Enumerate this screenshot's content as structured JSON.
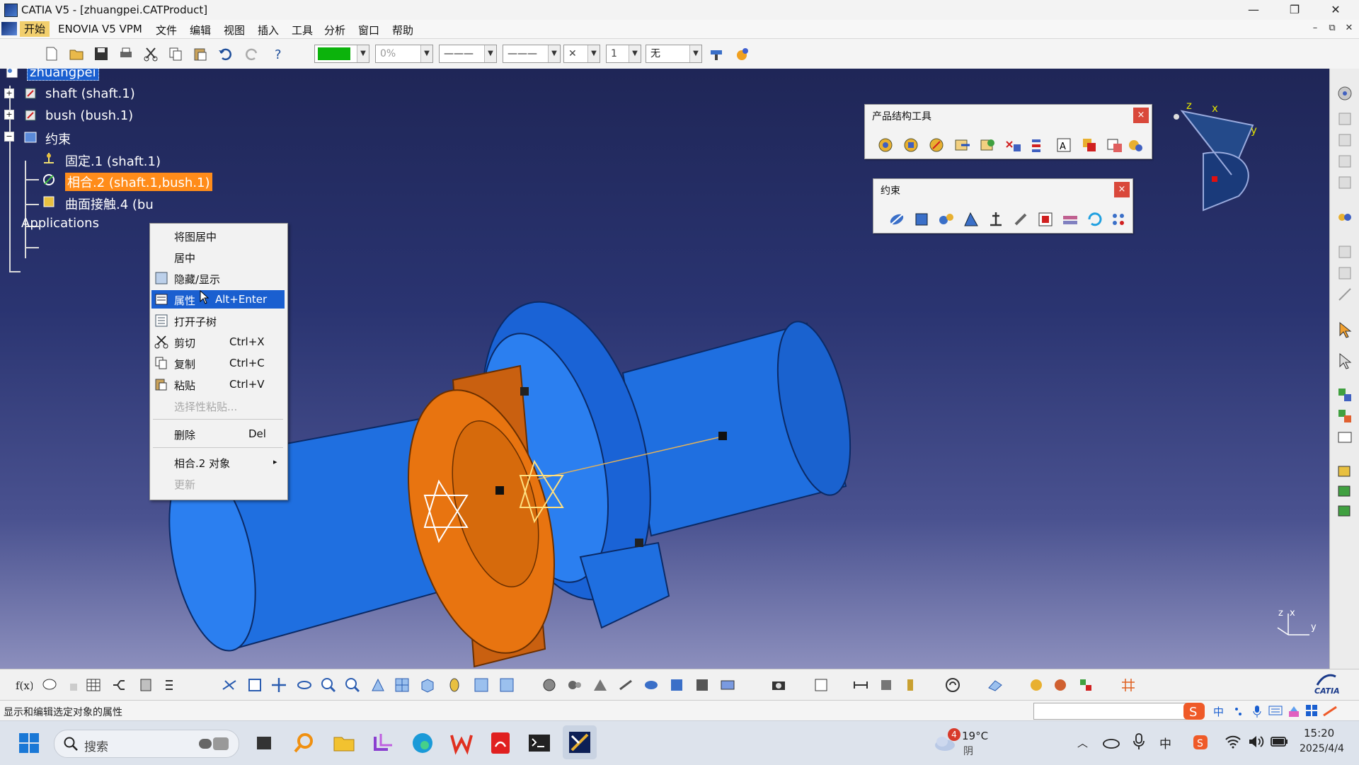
{
  "window": {
    "title": "CATIA V5 - [zhuangpei.CATProduct]",
    "controls": [
      "—",
      "❐",
      "✕"
    ]
  },
  "menubar": {
    "items": [
      "开始",
      "ENOVIA V5 VPM",
      "文件",
      "编辑",
      "视图",
      "插入",
      "工具",
      "分析",
      "窗口",
      "帮助"
    ],
    "mdi_controls": [
      "–",
      "⧉",
      "✕"
    ]
  },
  "toolbar": {
    "color_value": "",
    "transparency_value": "0%",
    "layer_value": "无",
    "linetype_value": "———",
    "lineweight_value": "———",
    "point_value": "✕",
    "misc_value": "1"
  },
  "tree": {
    "root": "zhuangpei",
    "items": [
      {
        "label": "shaft (shaft.1)"
      },
      {
        "label": "bush (bush.1)"
      },
      {
        "label": "约束"
      },
      {
        "label": "固定.1 (shaft.1)"
      },
      {
        "label": "相合.2 (shaft.1,bush.1)"
      },
      {
        "label": "曲面接触.4 (bu"
      },
      {
        "label": "Applications"
      }
    ]
  },
  "panels": {
    "product_tools": {
      "title": "产品结构工具",
      "close": "×"
    },
    "constraints": {
      "title": "约束",
      "close": "×"
    }
  },
  "compass": {
    "x": "x",
    "y": "y",
    "z": "z"
  },
  "axis_triad": {
    "z": "z",
    "x": "x",
    "y": "y"
  },
  "context_menu": {
    "items": [
      {
        "label": "将图居中",
        "shortcut": ""
      },
      {
        "label": "居中",
        "shortcut": ""
      },
      {
        "label": "隐藏/显示",
        "shortcut": ""
      },
      {
        "label": "属性",
        "shortcut": "Alt+Enter"
      },
      {
        "label": "打开子树",
        "shortcut": ""
      },
      {
        "label": "剪切",
        "shortcut": "Ctrl+X"
      },
      {
        "label": "复制",
        "shortcut": "Ctrl+C"
      },
      {
        "label": "粘贴",
        "shortcut": "Ctrl+V"
      },
      {
        "label": "选择性粘贴...",
        "shortcut": ""
      },
      {
        "label": "删除",
        "shortcut": "Del"
      },
      {
        "label": "相合.2 对象",
        "shortcut": "▸"
      },
      {
        "label": "更新",
        "shortcut": ""
      }
    ]
  },
  "statusbar": {
    "text": "显示和编辑选定对象的属性"
  },
  "brand": {
    "catia": "CATIA"
  },
  "taskbar": {
    "search_placeholder": "搜索",
    "weather_temp": "19°C",
    "weather_desc": "阴",
    "weather_badge": "4",
    "ime_label": "中",
    "tray_lang": "中",
    "time": "15:20",
    "date": "2025/4/4"
  },
  "colors": {
    "shaft_blue": "#1f6fe0",
    "bush_orange": "#e87410",
    "selection_orange": "#ff8c1a",
    "highlight_blue": "#1a5fd0",
    "close_red": "#d9483b"
  }
}
